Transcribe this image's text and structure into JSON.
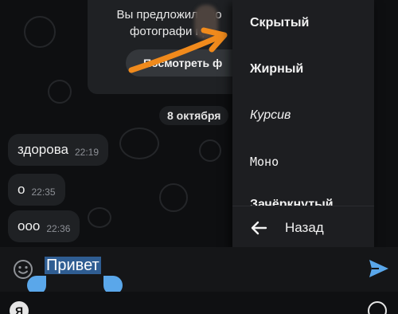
{
  "suggestion": {
    "text_line1": "Вы предложили до",
    "text_line2": "фотографи пр",
    "button_label": "Посмотреть ф"
  },
  "date_chip": "8 октября",
  "messages": [
    {
      "text": "здорова",
      "time": "22:19"
    },
    {
      "text": "о",
      "time": "22:35"
    },
    {
      "text": "ооо",
      "time": "22:36"
    }
  ],
  "format_menu": {
    "items": [
      {
        "label": "Скрытый",
        "style": "spoiler"
      },
      {
        "label": "Жирный",
        "style": "bold"
      },
      {
        "label": "Курсив",
        "style": "italic"
      },
      {
        "label": "Моно",
        "style": "mono"
      },
      {
        "label": "Зачёркнутый",
        "style": "strike"
      }
    ],
    "back_label": "Назад"
  },
  "composer": {
    "text": "Привет"
  },
  "keyboard": {
    "logo_letter": "Я"
  },
  "colors": {
    "accent": "#5aa7ea",
    "selection": "#2f5d92",
    "annotation_arrow": "#f08a1c"
  },
  "icons": {
    "emoji": "smile-icon",
    "send": "send-icon",
    "back": "arrow-left-icon"
  }
}
